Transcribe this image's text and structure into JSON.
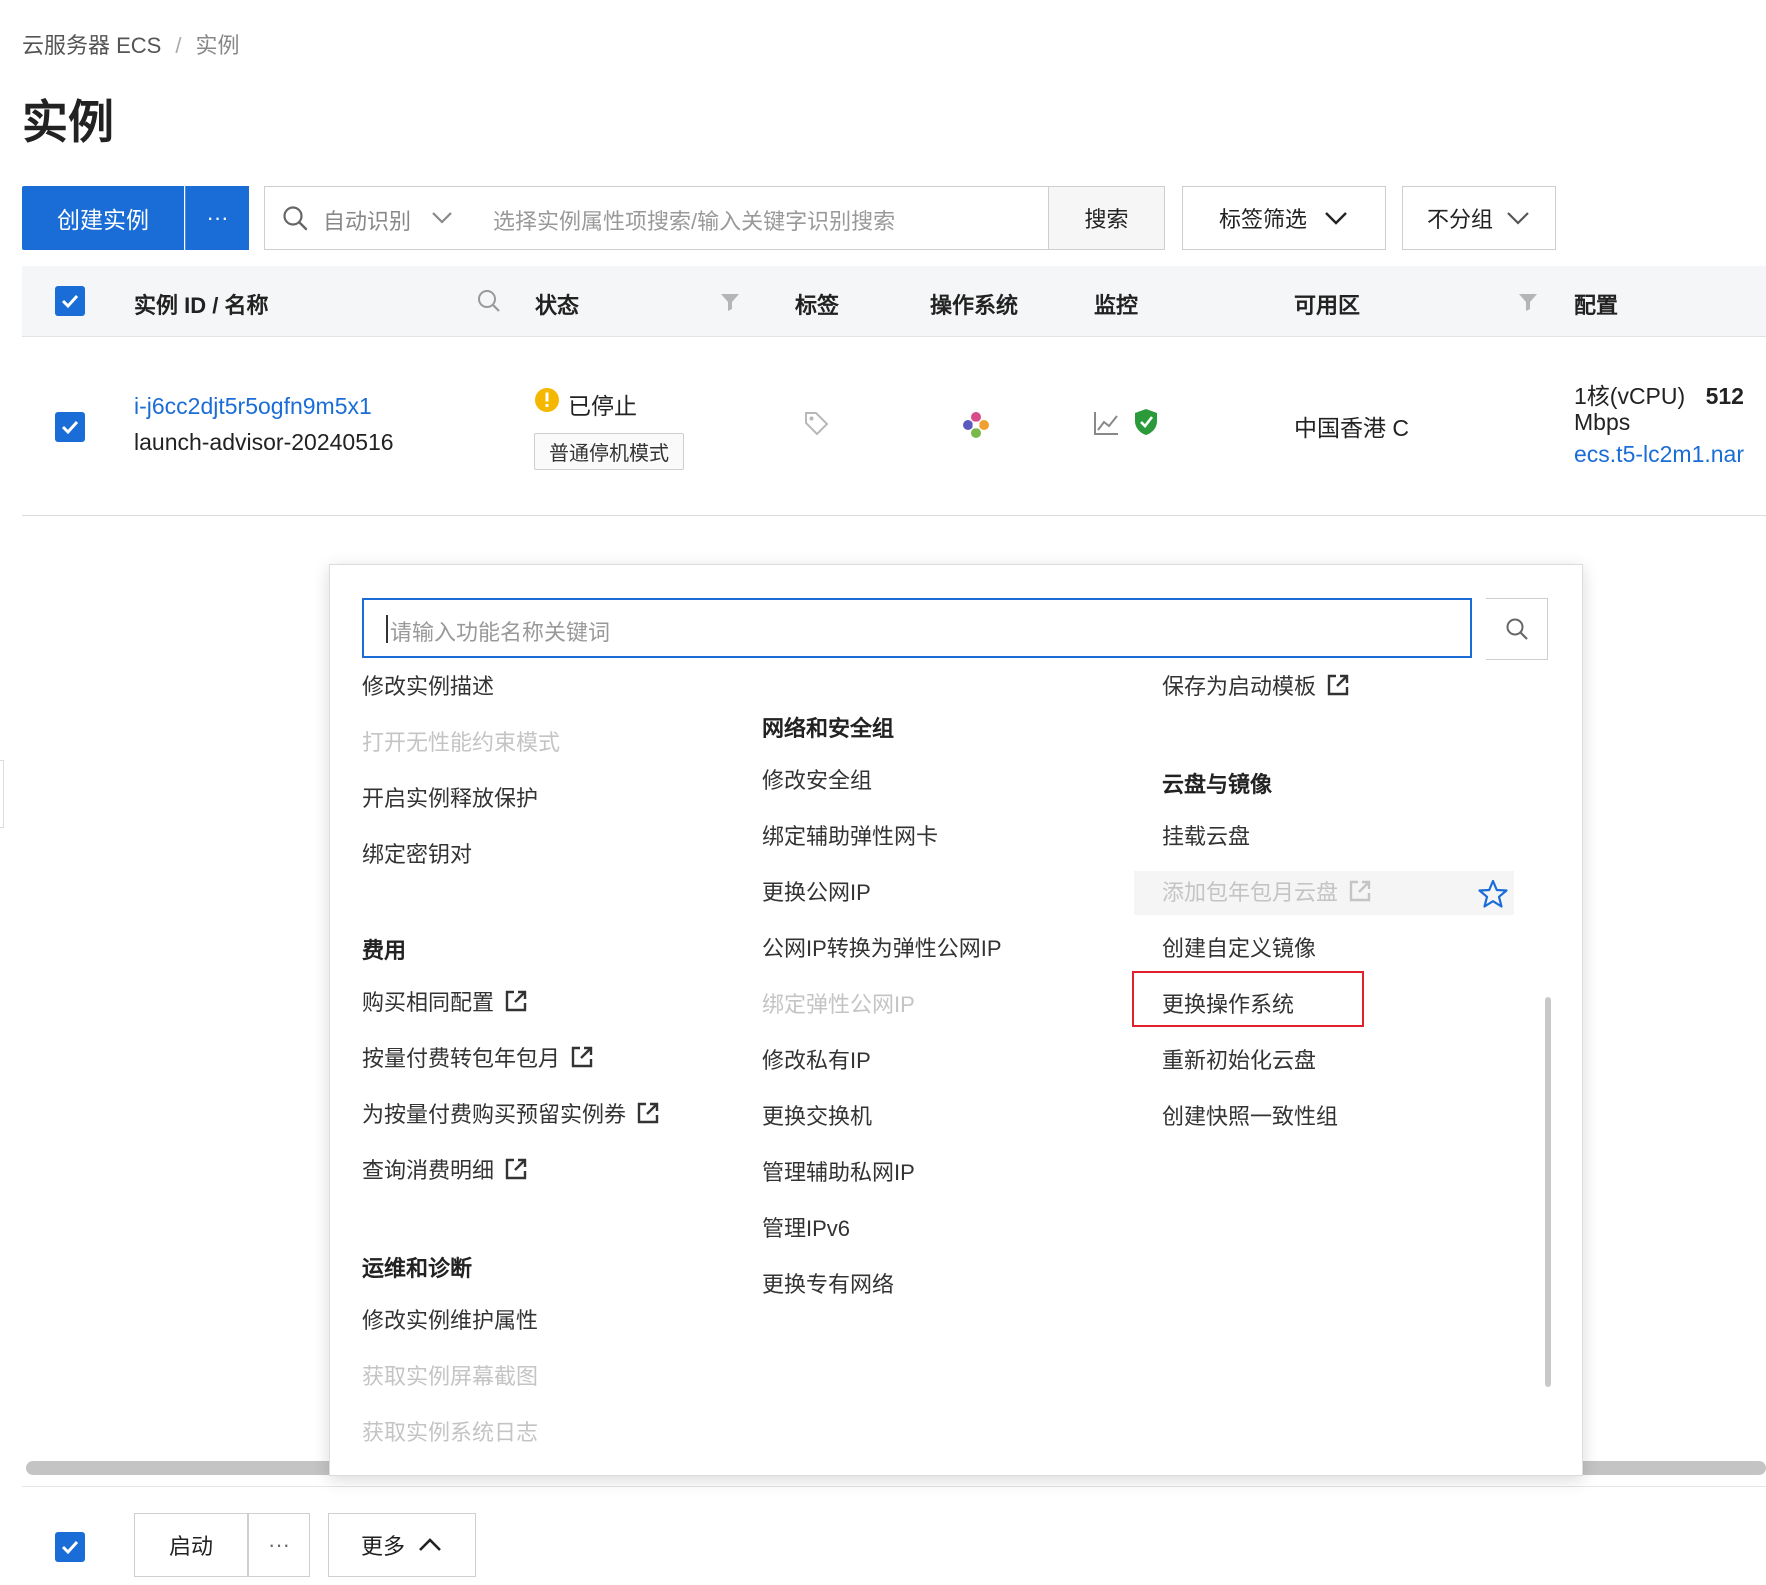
{
  "breadcrumb": {
    "root": "云服务器 ECS",
    "separator": "/",
    "current": "实例"
  },
  "page_title": "实例",
  "toolbar": {
    "create_label": "创建实例",
    "more_label": "···",
    "search_mode": "自动识别",
    "search_placeholder": "选择实例属性项搜索/输入关键字识别搜索",
    "search_button": "搜索",
    "tag_filter": "标签筛选",
    "group_select": "不分组"
  },
  "table": {
    "headers": {
      "instance": "实例 ID / 名称",
      "status": "状态",
      "tags": "标签",
      "os": "操作系统",
      "monitor": "监控",
      "zone": "可用区",
      "config": "配置"
    },
    "row": {
      "instance_id": "i-j6cc2djt5r5ogfn9m5x1",
      "instance_name": "launch-advisor-20240516",
      "status": "已停止",
      "stop_mode": "普通停机模式",
      "zone": "中国香港 C",
      "cpu": "1核(vCPU)",
      "bandwidth_value": "512",
      "bandwidth_unit": "Mbps",
      "instance_type": "ecs.t5-lc2m1.nar"
    }
  },
  "menu": {
    "search_placeholder": "请输入功能名称关键词",
    "col1": {
      "items_top": [
        {
          "label": "修改实例描述",
          "disabled": false
        },
        {
          "label": "打开无性能约束模式",
          "disabled": true
        },
        {
          "label": "开启实例释放保护",
          "disabled": false
        },
        {
          "label": "绑定密钥对",
          "disabled": false
        }
      ],
      "billing_title": "费用",
      "billing_items": [
        {
          "label": "购买相同配置",
          "external": true
        },
        {
          "label": "按量付费转包年包月",
          "external": true
        },
        {
          "label": "为按量付费购买预留实例券",
          "external": true
        },
        {
          "label": "查询消费明细",
          "external": true
        }
      ],
      "ops_title": "运维和诊断",
      "ops_items": [
        {
          "label": "修改实例维护属性",
          "disabled": false
        },
        {
          "label": "获取实例屏幕截图",
          "disabled": true
        },
        {
          "label": "获取实例系统日志",
          "disabled": true
        }
      ]
    },
    "col2": {
      "title": "网络和安全组",
      "items": [
        {
          "label": "修改安全组",
          "disabled": false
        },
        {
          "label": "绑定辅助弹性网卡",
          "disabled": false
        },
        {
          "label": "更换公网IP",
          "disabled": false
        },
        {
          "label": "公网IP转换为弹性公网IP",
          "disabled": false
        },
        {
          "label": "绑定弹性公网IP",
          "disabled": true
        },
        {
          "label": "修改私有IP",
          "disabled": false
        },
        {
          "label": "更换交换机",
          "disabled": false
        },
        {
          "label": "管理辅助私网IP",
          "disabled": false
        },
        {
          "label": "管理IPv6",
          "disabled": false
        },
        {
          "label": "更换专有网络",
          "disabled": false
        }
      ]
    },
    "col3": {
      "save_template": "保存为启动模板",
      "title": "云盘与镜像",
      "items": [
        {
          "label": "挂载云盘",
          "disabled": false
        },
        {
          "label": "添加包年包月云盘",
          "disabled": true
        },
        {
          "label": "创建自定义镜像",
          "disabled": false
        },
        {
          "label": "更换操作系统",
          "disabled": false
        },
        {
          "label": "重新初始化云盘",
          "disabled": false
        },
        {
          "label": "创建快照一致性组",
          "disabled": false
        }
      ]
    }
  },
  "bottom": {
    "start_label": "启动",
    "more_dots": "···",
    "more_label": "更多"
  },
  "colors": {
    "primary": "#1a6dd6",
    "highlight_border": "#e0202b",
    "warning": "#f5b800",
    "shield": "#2a9a3a"
  }
}
